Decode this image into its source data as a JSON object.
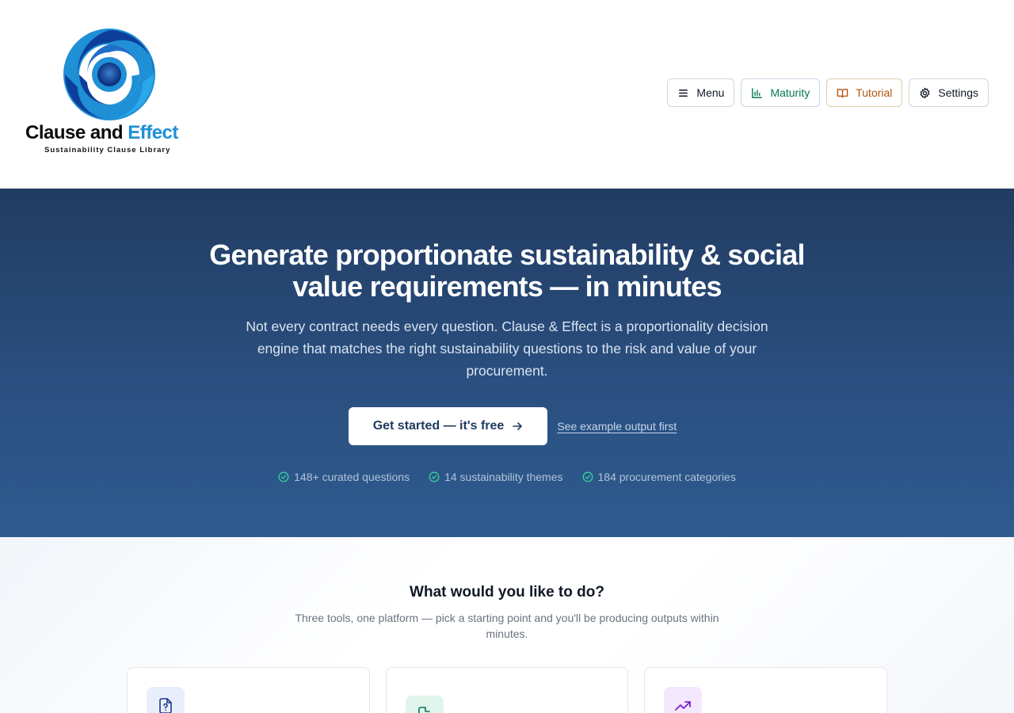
{
  "brand": {
    "name_part1": "Clause and",
    "name_part2": "Effect",
    "tagline": "Sustainability Clause Library"
  },
  "nav": {
    "menu": "Menu",
    "maturity": "Maturity",
    "tutorial": "Tutorial",
    "settings": "Settings"
  },
  "hero": {
    "title_line1": "Generate proportionate sustainability & social",
    "title_line2": "value requirements — in minutes",
    "subtitle": "Not every contract needs every question. Clause & Effect is a proportionality decision engine that matches the right sustainability questions to the risk and value of your procurement.",
    "cta_primary": "Get started — it's free",
    "cta_secondary": "See example output first",
    "stats": [
      "148+ curated questions",
      "14 sustainability themes",
      "184 procurement categories"
    ]
  },
  "tools": {
    "title": "What would you like to do?",
    "subtitle": "Three tools, one platform — pick a starting point and you'll be producing outputs within minutes.",
    "cards": [
      {
        "icon": "file-question-icon"
      },
      {
        "icon": "file-edit-icon"
      },
      {
        "icon": "trending-up-icon"
      }
    ]
  },
  "colors": {
    "hero_top": "#223c62",
    "hero_bottom": "#2e5b8f",
    "maturity": "#047857",
    "tutorial": "#b45309",
    "brand_blue": "#1f8fd6"
  }
}
